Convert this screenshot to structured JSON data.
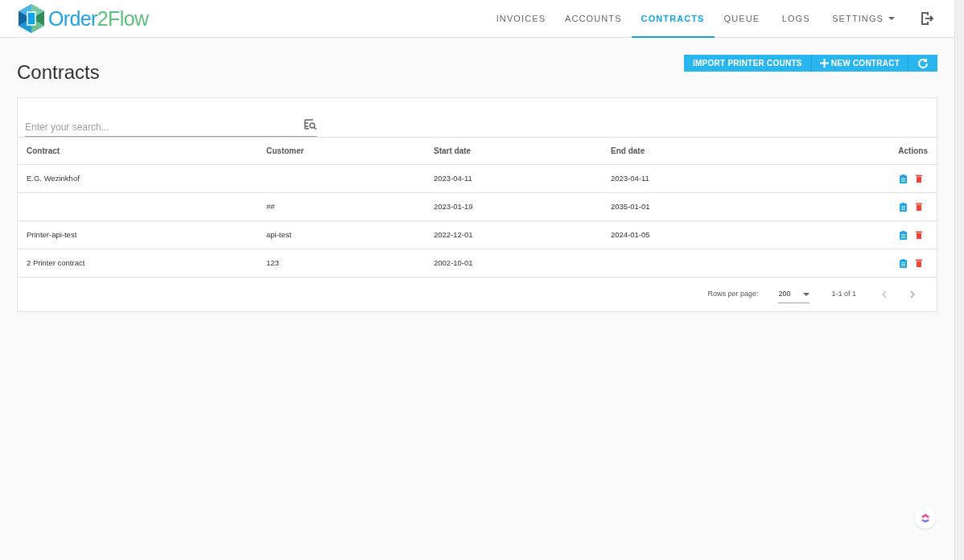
{
  "logo": {
    "part_1": "Order",
    "part_2": "2Flow"
  },
  "nav": [
    {
      "label": "INVOICES",
      "selected": false
    },
    {
      "label": "ACCOUNTS",
      "selected": false
    },
    {
      "label": "CONTRACTS",
      "selected": true
    },
    {
      "label": "QUEUE",
      "selected": false
    },
    {
      "label": "LOGS",
      "selected": false
    },
    {
      "label": "SETTINGS",
      "selected": false,
      "kind": "dropdown"
    }
  ],
  "page_title": "Contracts",
  "toolbar": {
    "import_button": "IMPORT PRINTER COUNTS",
    "new_button": "NEW CONTRACT"
  },
  "search": {
    "placeholder": "Enter your search..."
  },
  "table": {
    "columns": [
      "Contract",
      "Customer",
      "Start date",
      "End date",
      "Actions"
    ],
    "rows": [
      {
        "contract": "E.G. Wezinkhof",
        "customer": "",
        "start": "2023-04-11",
        "end": "2023-04-11"
      },
      {
        "contract": "",
        "customer": "##",
        "start": "2023-01-19",
        "end": "2035-01-01"
      },
      {
        "contract": "Printer-api-test",
        "customer": "api-test",
        "start": "2022-12-01",
        "end": "2024-01-05"
      },
      {
        "contract": "2 Printer contract",
        "customer": "123",
        "start": "2002-10-01",
        "end": ""
      }
    ]
  },
  "pagination": {
    "rows_per_page_label": "Rows per page:",
    "rows_per_page": "200",
    "range": "1-1 of 1"
  }
}
